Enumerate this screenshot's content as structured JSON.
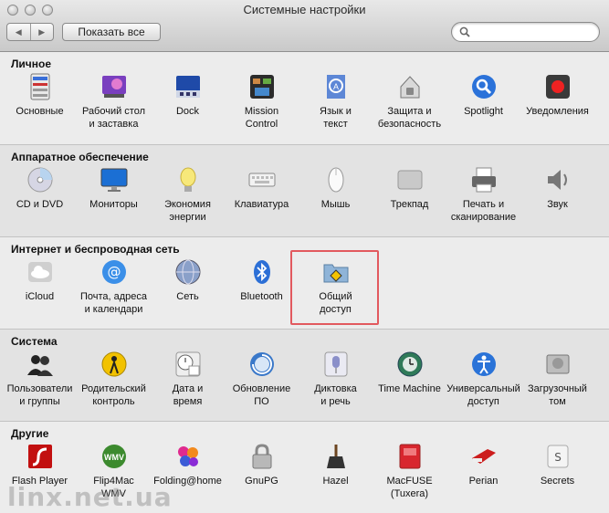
{
  "window": {
    "title": "Системные настройки"
  },
  "toolbar": {
    "back_glyph": "◀",
    "forward_glyph": "▶",
    "show_all": "Показать все",
    "search_value": "",
    "search_icon": "magnifier-icon"
  },
  "sections": [
    {
      "title": "Личное",
      "items": [
        {
          "name": "Основные",
          "icon": "general-icon"
        },
        {
          "name": "Рабочий стол\nи заставка",
          "icon": "desktop-icon"
        },
        {
          "name": "Dock",
          "icon": "dock-icon"
        },
        {
          "name": "Mission\nControl",
          "icon": "mission-control-icon"
        },
        {
          "name": "Язык и\nтекст",
          "icon": "language-icon"
        },
        {
          "name": "Защита и\nбезопасность",
          "icon": "security-icon"
        },
        {
          "name": "Spotlight",
          "icon": "spotlight-icon"
        },
        {
          "name": "Уведомления",
          "icon": "notifications-icon"
        }
      ]
    },
    {
      "title": "Аппаратное обеспечение",
      "items": [
        {
          "name": "CD и DVD",
          "icon": "cd-icon"
        },
        {
          "name": "Мониторы",
          "icon": "monitor-icon"
        },
        {
          "name": "Экономия\nэнергии",
          "icon": "bulb-icon"
        },
        {
          "name": "Клавиатура",
          "icon": "keyboard-icon"
        },
        {
          "name": "Мышь",
          "icon": "mouse-icon"
        },
        {
          "name": "Трекпад",
          "icon": "trackpad-icon"
        },
        {
          "name": "Печать и\nсканирование",
          "icon": "printer-icon"
        },
        {
          "name": "Звук",
          "icon": "speaker-icon"
        }
      ]
    },
    {
      "title": "Интернет и беспроводная сеть",
      "items": [
        {
          "name": "iCloud",
          "icon": "icloud-icon"
        },
        {
          "name": "Почта, адреса\nи календари",
          "icon": "mail-icon"
        },
        {
          "name": "Сеть",
          "icon": "network-icon"
        },
        {
          "name": "Bluetooth",
          "icon": "bluetooth-icon"
        },
        {
          "name": "Общий\nдоступ",
          "icon": "sharing-icon"
        }
      ]
    },
    {
      "title": "Система",
      "items": [
        {
          "name": "Пользователи\nи группы",
          "icon": "users-icon"
        },
        {
          "name": "Родительский\nконтроль",
          "icon": "parental-icon"
        },
        {
          "name": "Дата и\nвремя",
          "icon": "clock-icon"
        },
        {
          "name": "Обновление\nПО",
          "icon": "update-icon"
        },
        {
          "name": "Диктовка\nи речь",
          "icon": "microphone-icon"
        },
        {
          "name": "Time Machine",
          "icon": "time-machine-icon"
        },
        {
          "name": "Универсальный\nдоступ",
          "icon": "accessibility-icon"
        },
        {
          "name": "Загрузочный\nтом",
          "icon": "startup-disk-icon"
        }
      ]
    },
    {
      "title": "Другие",
      "items": [
        {
          "name": "Flash Player",
          "icon": "flash-icon"
        },
        {
          "name": "Flip4Mac\nWMV",
          "icon": "wmv-icon"
        },
        {
          "name": "Folding@home",
          "icon": "folding-icon"
        },
        {
          "name": "GnuPG",
          "icon": "lock-icon"
        },
        {
          "name": "Hazel",
          "icon": "broom-icon"
        },
        {
          "name": "MacFUSE\n(Tuxera)",
          "icon": "macfuse-icon"
        },
        {
          "name": "Perian",
          "icon": "perian-icon"
        },
        {
          "name": "Secrets",
          "icon": "secrets-icon"
        }
      ]
    }
  ],
  "watermark": "linx.net.ua"
}
